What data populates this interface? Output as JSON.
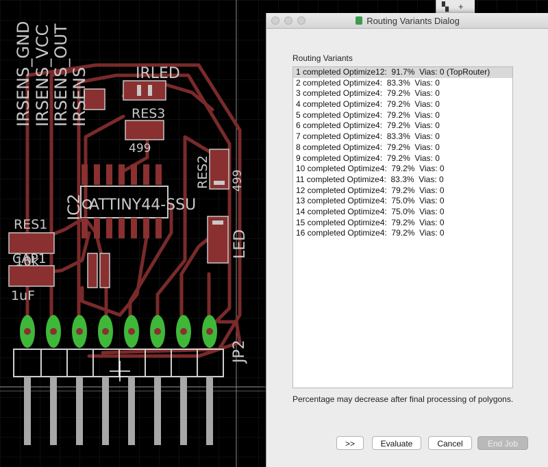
{
  "pcb": {
    "labels": {
      "irsens_gnd": "IRSENS_GND",
      "irsens_vcc": "IRSENS_VCC",
      "irsens_out": "IRSENS_OUT",
      "irsens": "IRSENS",
      "irled": "IRLED",
      "res3": "RES3",
      "res3_value": "499",
      "res2": "RES2",
      "res2_value": "499",
      "ic2": "IC2",
      "attiny": "ATTINY44-SSU",
      "res1": "RES1",
      "res1_value": "10k",
      "cap1": "CAP1",
      "cap1_value": "1uF",
      "led": "LED",
      "jp2": "JP2"
    }
  },
  "dialog": {
    "title": "Routing Variants Dialog",
    "section_label": "Routing Variants",
    "variants": [
      "1 completed Optimize12:  91.7%  Vias: 0 (TopRouter)",
      "2 completed Optimize4:  83.3%  Vias: 0",
      "3 completed Optimize4:  79.2%  Vias: 0",
      "4 completed Optimize4:  79.2%  Vias: 0",
      "5 completed Optimize4:  79.2%  Vias: 0",
      "6 completed Optimize4:  79.2%  Vias: 0",
      "7 completed Optimize4:  83.3%  Vias: 0",
      "8 completed Optimize4:  79.2%  Vias: 0",
      "9 completed Optimize4:  79.2%  Vias: 0",
      "10 completed Optimize4:  79.2%  Vias: 0",
      "11 completed Optimize4:  83.3%  Vias: 0",
      "12 completed Optimize4:  79.2%  Vias: 0",
      "13 completed Optimize4:  75.0%  Vias: 0",
      "14 completed Optimize4:  75.0%  Vias: 0",
      "15 completed Optimize4:  79.2%  Vias: 0",
      "16 completed Optimize4:  79.2%  Vias: 0"
    ],
    "selected_index": 0,
    "note": "Percentage may decrease after final processing of polygons.",
    "buttons": {
      "next": ">>",
      "evaluate": "Evaluate",
      "cancel": "Cancel",
      "end_job": "End Job"
    }
  }
}
